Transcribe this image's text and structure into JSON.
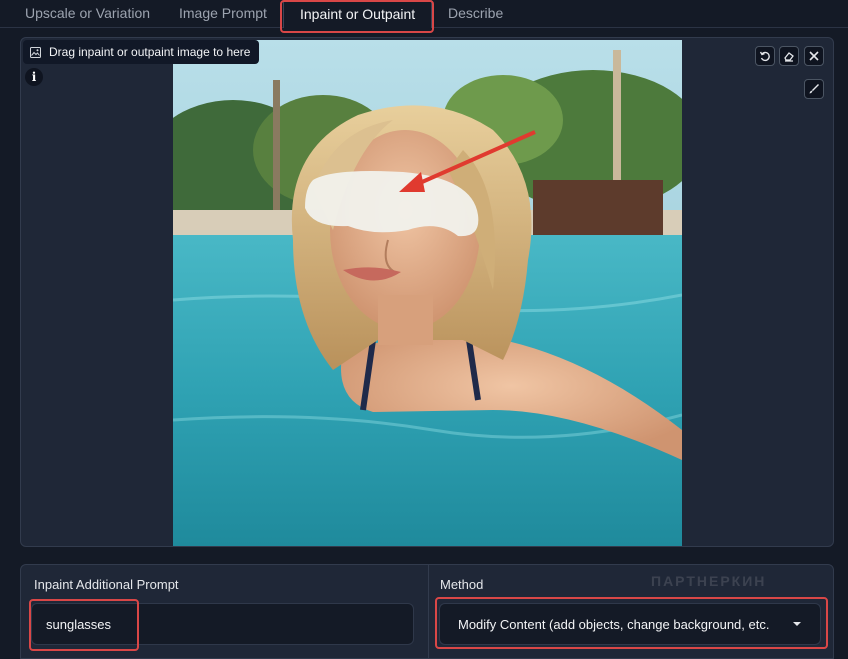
{
  "tabs": [
    {
      "label": "Upscale or Variation",
      "active": false
    },
    {
      "label": "Image Prompt",
      "active": false
    },
    {
      "label": "Inpaint or Outpaint",
      "active": true
    },
    {
      "label": "Describe",
      "active": false
    }
  ],
  "image_panel": {
    "drop_label": "Drag inpaint or outpaint image to here",
    "info_icon": "info-icon",
    "controls": [
      "undo-icon",
      "eraser-icon",
      "close-icon",
      "brush-icon"
    ]
  },
  "inpaint_prompt": {
    "label": "Inpaint Additional Prompt",
    "value": "sunglasses"
  },
  "method": {
    "label": "Method",
    "selected": "Modify Content (add objects, change background, etc."
  },
  "watermark": {
    "text": "ПАРТНЕРКИН"
  },
  "colors": {
    "highlight": "#d94747",
    "background": "#141a26",
    "panel": "#1f2737"
  }
}
